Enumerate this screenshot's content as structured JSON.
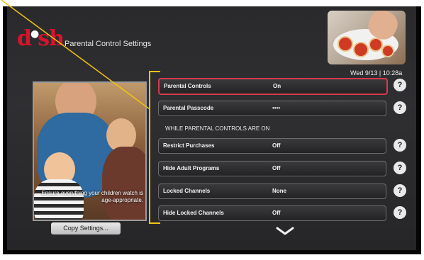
{
  "header": {
    "logo_text": "dish",
    "title": "Parental Control Settings"
  },
  "clock": "Wed 9/13 | 10:28a",
  "promo": {
    "caption": "Ensure everything your children watch is age-appropriate."
  },
  "copy_button_label": "Copy Settings...",
  "section_header": "WHILE PARENTAL CONTROLS ARE ON",
  "settings": [
    {
      "label": "Parental Controls",
      "value": "On",
      "help": "?"
    },
    {
      "label": "Parental Passcode",
      "value": "••••",
      "help": "?"
    },
    {
      "label": "Restrict Purchases",
      "value": "Off",
      "help": "?"
    },
    {
      "label": "Hide Adult Programs",
      "value": "Off",
      "help": "?"
    },
    {
      "label": "Locked Channels",
      "value": "None",
      "help": "?"
    },
    {
      "label": "Hide Locked Channels",
      "value": "Off",
      "help": "?"
    }
  ],
  "icons": {
    "help": "question-icon",
    "more": "chevron-down-icon"
  },
  "colors": {
    "brand_red": "#d8132b",
    "selection": "#d63a4e",
    "annotation": "#f1c40f"
  }
}
